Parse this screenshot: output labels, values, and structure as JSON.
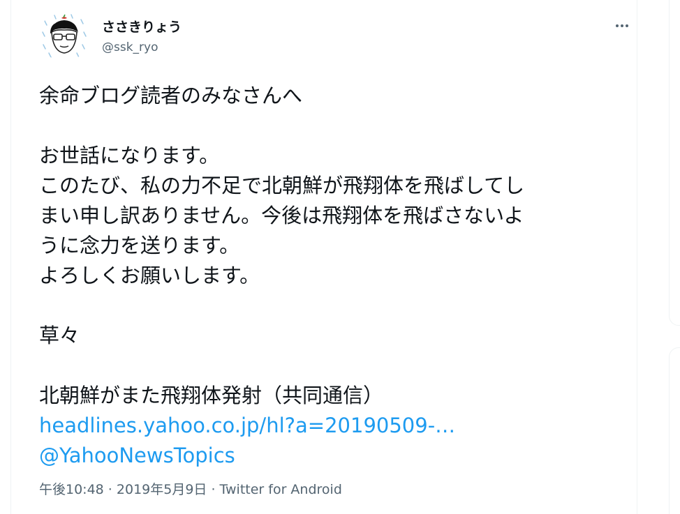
{
  "author": {
    "name": "ささきりょう",
    "handle": "@ssk_ryo",
    "avatar_icon": "cartoon-avatar-icon"
  },
  "more_icon": "more-horizontal-icon",
  "tweet": {
    "lines": [
      "余命ブログ読者のみなさんへ",
      "",
      "お世話になります。",
      "このたび、私の力不足で北朝鮮が飛翔体を飛ばしてし",
      "まい申し訳ありません。今後は飛翔体を飛ばさないよ",
      "うに念力を送ります。",
      "よろしくお願いします。",
      "",
      "草々",
      "",
      "北朝鮮がまた飛翔体発射（共同通信）"
    ],
    "link_url_text": "headlines.yahoo.co.jp/hl?a=20190509-…",
    "mention": "@YahooNewsTopics"
  },
  "meta": {
    "time": "午後10:48",
    "separator": " · ",
    "date": "2019年5月9日",
    "source": "Twitter for Android"
  },
  "colors": {
    "text": "#0f1419",
    "secondary": "#536471",
    "link": "#1d9bf0",
    "border": "#eff3f4"
  }
}
